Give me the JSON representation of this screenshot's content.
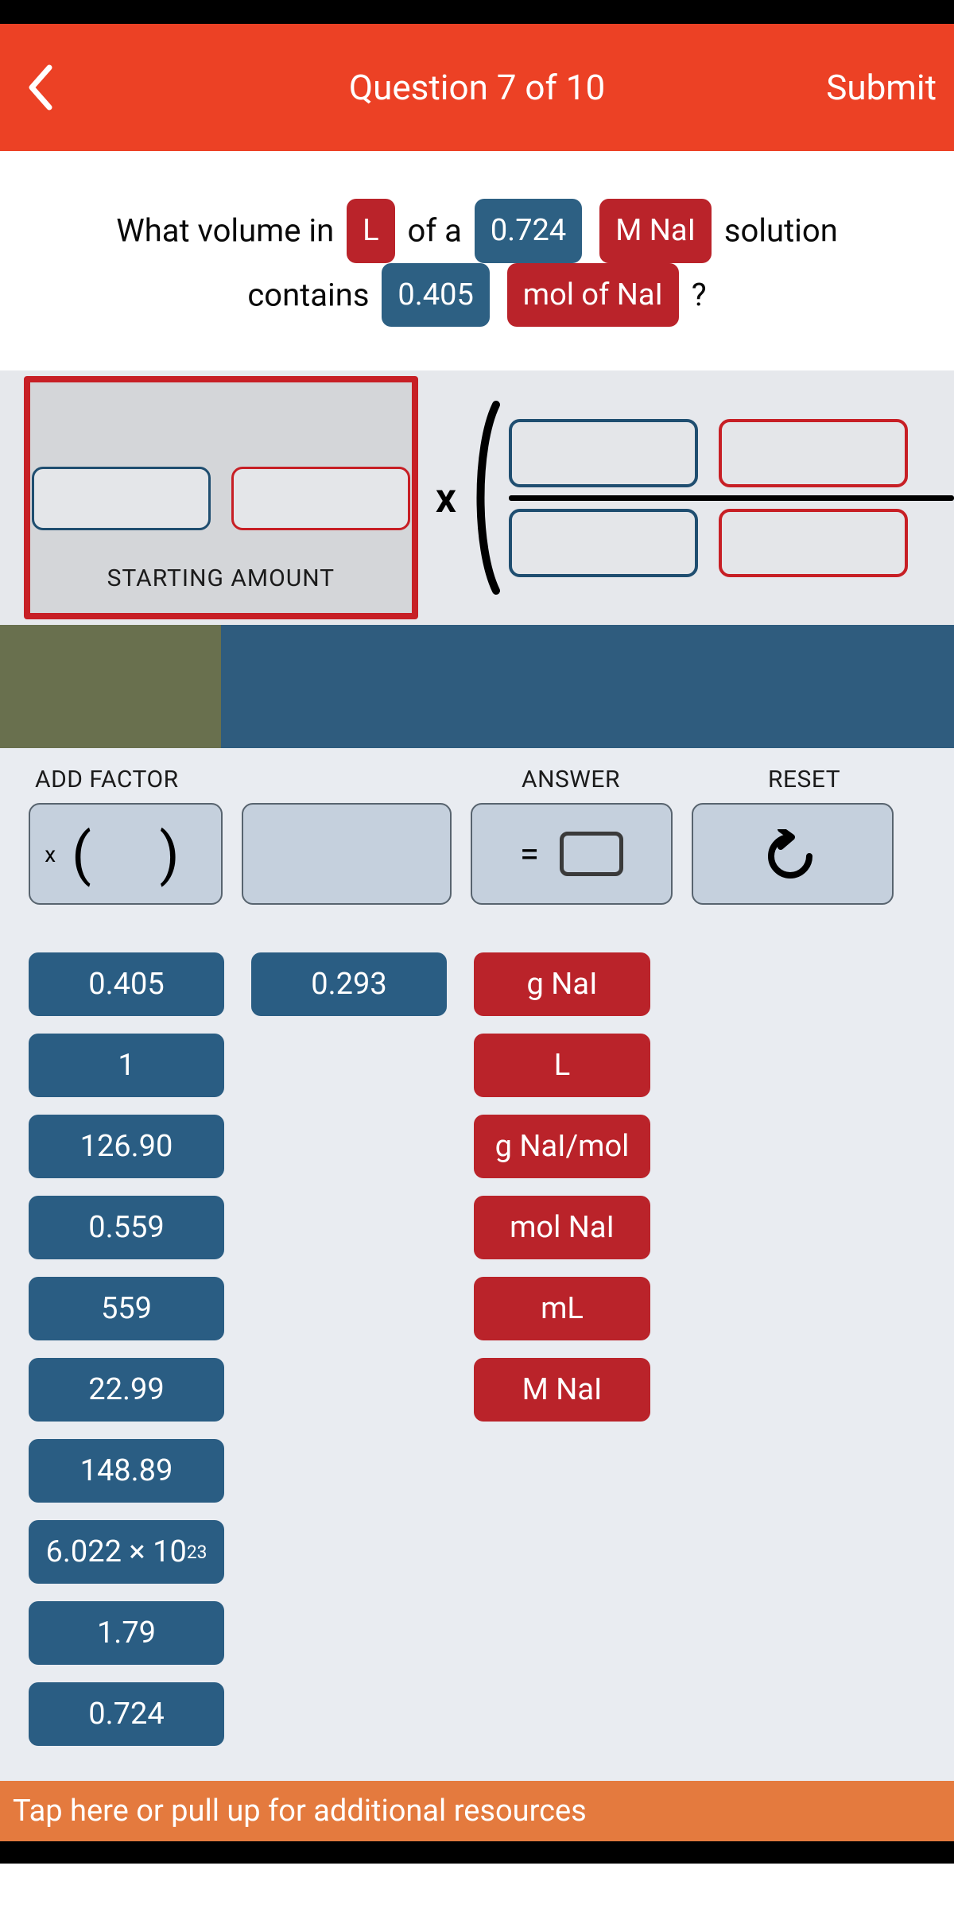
{
  "header": {
    "title": "Question 7 of 10",
    "submit": "Submit"
  },
  "question": {
    "t1": "What volume in",
    "chip_L": "L",
    "t2": "of a",
    "chip_M": "0.724",
    "chip_MNaI": "M NaI",
    "t3": "solution",
    "t4": "contains",
    "chip_mol": "0.405",
    "chip_molNaI": "mol of NaI",
    "t5": "?"
  },
  "starting_label": "STARTING AMOUNT",
  "times": "x",
  "tool_labels": {
    "add_factor": "ADD FACTOR",
    "answer": "ANSWER",
    "reset": "RESET"
  },
  "answer_eq": "=",
  "choices": {
    "col1": [
      "0.405",
      "1",
      "126.90",
      "0.559",
      "559",
      "22.99",
      "148.89",
      "6.022 × 10^23",
      "1.79",
      "0.724"
    ],
    "col2": [
      "0.293"
    ],
    "col3": [
      "g NaI",
      "L",
      "g NaI/mol",
      "mol NaI",
      "mL",
      "M NaI"
    ]
  },
  "footer_text": "Tap here or pull up for additional resources"
}
